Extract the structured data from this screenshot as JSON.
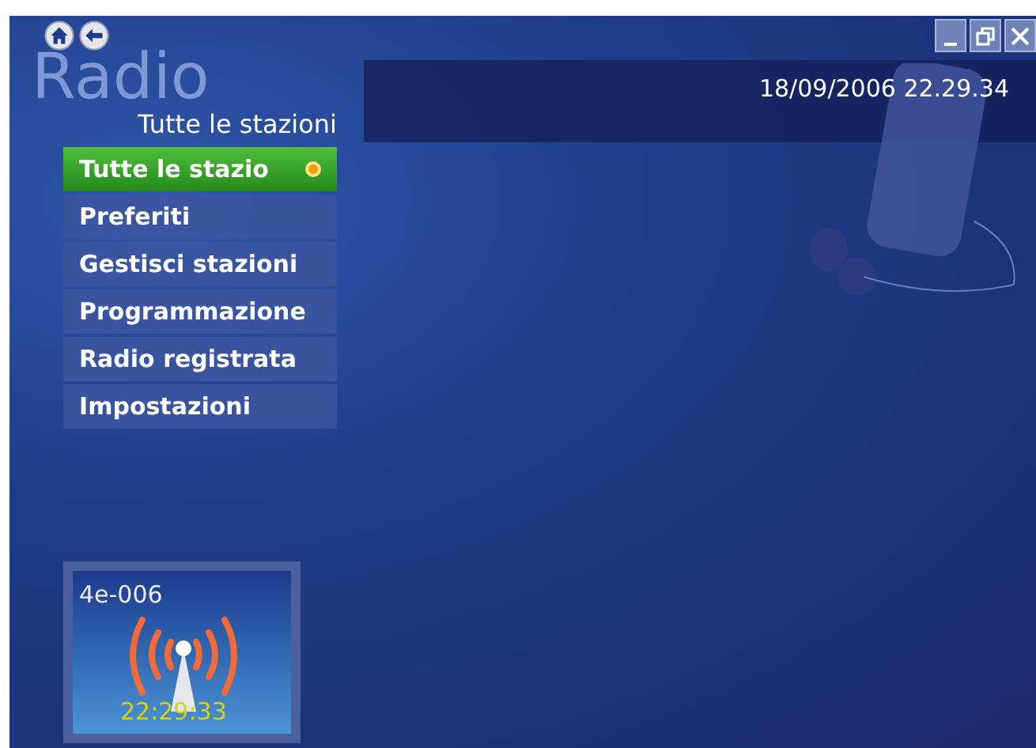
{
  "nav_buttons": [
    {
      "kind": "home"
    },
    {
      "kind": "back"
    }
  ],
  "window_controls": [
    {
      "kind": "minimize"
    },
    {
      "kind": "restore"
    },
    {
      "kind": "close"
    }
  ],
  "page_title": "Radio",
  "section_title": "Tutte le stazioni",
  "datetime": "18/09/2006 22.29.34",
  "menu": [
    {
      "label": "Tutte le stazio",
      "selected": true
    },
    {
      "label": "Preferiti",
      "selected": false
    },
    {
      "label": "Gestisci stazioni",
      "selected": false
    },
    {
      "label": "Programmazione",
      "selected": false
    },
    {
      "label": "Radio registrata",
      "selected": false
    },
    {
      "label": "Impostazioni",
      "selected": false
    }
  ],
  "now_playing": {
    "station": "4e-006",
    "time": "22:29:33"
  }
}
